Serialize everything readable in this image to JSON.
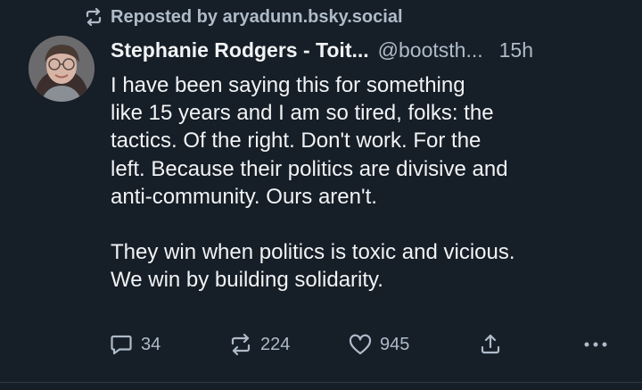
{
  "repost": {
    "icon": "repost-icon",
    "label": "Reposted by aryadunn.bsky.social"
  },
  "author": {
    "display_name": "Stephanie Rodgers - Toit...",
    "handle": "@bootsth...",
    "timestamp": "15h"
  },
  "post": {
    "text": "I have been saying this for something\nlike 15 years and I am so tired, folks: the\ntactics. Of the right. Don't work. For the\nleft. Because their politics are divisive and\nanti-community. Ours aren't.\n\nThey win when politics is toxic and vicious.\nWe win by building solidarity."
  },
  "actions": {
    "reply": {
      "icon": "reply-icon",
      "count": "34"
    },
    "repost": {
      "icon": "repost-icon",
      "count": "224"
    },
    "like": {
      "icon": "heart-icon",
      "count": "945"
    },
    "share": {
      "icon": "share-icon"
    },
    "more": {
      "icon": "more-options-icon"
    }
  },
  "colors": {
    "background": "#161e27",
    "text": "#f1f3f5",
    "muted": "#aebbc9"
  }
}
